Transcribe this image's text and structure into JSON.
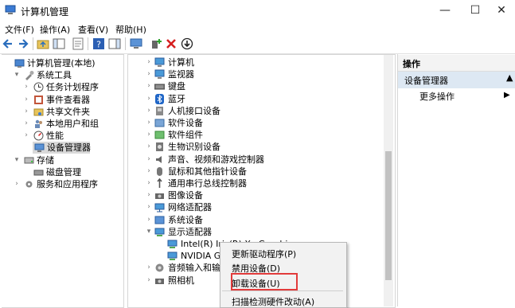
{
  "window": {
    "title": "计算机管理"
  },
  "menu": [
    "文件(F)",
    "操作(A)",
    "查看(V)",
    "帮助(H)"
  ],
  "left_tree": [
    {
      "label": "计算机管理(本地)",
      "level": 0,
      "arrow": "",
      "icon": "computer-mgmt-icon"
    },
    {
      "label": "系统工具",
      "level": 1,
      "arrow": "▾",
      "icon": "tools-icon"
    },
    {
      "label": "任务计划程序",
      "level": 2,
      "arrow": "›",
      "icon": "clock-icon"
    },
    {
      "label": "事件查看器",
      "level": 2,
      "arrow": "›",
      "icon": "event-viewer-icon"
    },
    {
      "label": "共享文件夹",
      "level": 2,
      "arrow": "›",
      "icon": "shared-folder-icon"
    },
    {
      "label": "本地用户和组",
      "level": 2,
      "arrow": "›",
      "icon": "users-icon"
    },
    {
      "label": "性能",
      "level": 2,
      "arrow": "›",
      "icon": "performance-icon"
    },
    {
      "label": "设备管理器",
      "level": 2,
      "arrow": "",
      "icon": "device-manager-icon",
      "selected": true
    },
    {
      "label": "存储",
      "level": 1,
      "arrow": "▾",
      "icon": "storage-icon"
    },
    {
      "label": "磁盘管理",
      "level": 2,
      "arrow": "",
      "icon": "disk-icon"
    },
    {
      "label": "服务和应用程序",
      "level": 1,
      "arrow": "›",
      "icon": "services-icon"
    }
  ],
  "device_tree": [
    {
      "label": "计算机",
      "arrow": "›",
      "icon": "monitor-icon",
      "indent": 0
    },
    {
      "label": "监视器",
      "arrow": "›",
      "icon": "monitor-icon",
      "indent": 0
    },
    {
      "label": "键盘",
      "arrow": "›",
      "icon": "keyboard-icon",
      "indent": 0
    },
    {
      "label": "蓝牙",
      "arrow": "›",
      "icon": "bluetooth-icon",
      "indent": 0
    },
    {
      "label": "人机接口设备",
      "arrow": "›",
      "icon": "hid-icon",
      "indent": 0
    },
    {
      "label": "软件设备",
      "arrow": "›",
      "icon": "software-device-icon",
      "indent": 0
    },
    {
      "label": "软件组件",
      "arrow": "›",
      "icon": "software-component-icon",
      "indent": 0
    },
    {
      "label": "生物识别设备",
      "arrow": "›",
      "icon": "biometric-icon",
      "indent": 0
    },
    {
      "label": "声音、视频和游戏控制器",
      "arrow": "›",
      "icon": "sound-icon",
      "indent": 0
    },
    {
      "label": "鼠标和其他指针设备",
      "arrow": "›",
      "icon": "mouse-icon",
      "indent": 0
    },
    {
      "label": "通用串行总线控制器",
      "arrow": "›",
      "icon": "usb-icon",
      "indent": 0
    },
    {
      "label": "图像设备",
      "arrow": "›",
      "icon": "camera-icon",
      "indent": 0
    },
    {
      "label": "网络适配器",
      "arrow": "›",
      "icon": "network-icon",
      "indent": 0
    },
    {
      "label": "系统设备",
      "arrow": "›",
      "icon": "system-device-icon",
      "indent": 0
    },
    {
      "label": "显示适配器",
      "arrow": "▾",
      "icon": "display-adapter-icon",
      "indent": 0
    },
    {
      "label": "Intel(R) Iris(R) Xe Graphics",
      "arrow": "",
      "icon": "display-adapter-icon",
      "indent": 1
    },
    {
      "label": "NVIDIA Ge",
      "arrow": "",
      "icon": "display-adapter-icon",
      "indent": 1
    },
    {
      "label": "音频输入和输出",
      "arrow": "›",
      "icon": "audio-icon",
      "indent": 0
    },
    {
      "label": "照相机",
      "arrow": "›",
      "icon": "camera-icon",
      "indent": 0
    }
  ],
  "actions": {
    "header": "操作",
    "section": "设备管理器",
    "more": "更多操作"
  },
  "context_menu": [
    "更新驱动程序(P)",
    "禁用设备(D)",
    "卸载设备(U)",
    "扫描检测硬件改动(A)"
  ],
  "colors": {
    "highlight_border": "#e23b3b",
    "selection_bg": "#d9d9d9"
  }
}
